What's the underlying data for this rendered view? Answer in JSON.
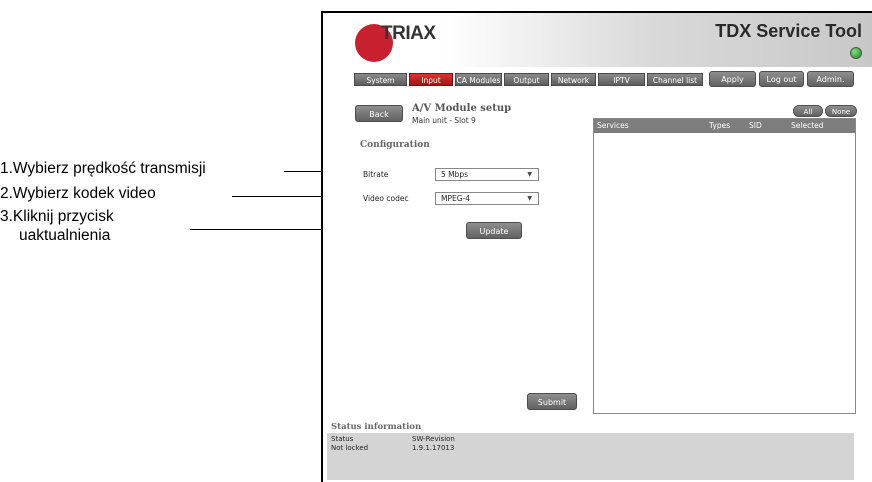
{
  "annotations": [
    {
      "text": "1.Wybierz prędkość transmisji"
    },
    {
      "text": "2.Wybierz kodek video"
    },
    {
      "text": "3.Kliknij przycisk"
    },
    {
      "text": "uaktualnienia"
    }
  ],
  "header": {
    "logo_text": "TRIAX",
    "title": "TDX Service Tool"
  },
  "nav": {
    "tabs": [
      {
        "label": "System"
      },
      {
        "label": "Input"
      },
      {
        "label": "CA Modules"
      },
      {
        "label": "Output"
      },
      {
        "label": "Network"
      },
      {
        "label": "IPTV"
      },
      {
        "label": "Channel list"
      }
    ],
    "active_tab": "Input",
    "apply": "Apply",
    "logout": "Log out",
    "admin": "Admin."
  },
  "panel": {
    "back": "Back",
    "title": "A/V Module setup",
    "subtitle": "Main unit - Slot 9",
    "config_title": "Configuration",
    "bitrate_label": "Bitrate",
    "bitrate_value": "5 Mbps",
    "codec_label": "Video codec",
    "codec_value": "MPEG-4",
    "update": "Update",
    "submit": "Submit"
  },
  "services": {
    "all": "All",
    "none": "None",
    "columns": [
      "Services",
      "Types",
      "SID",
      "Selected services"
    ]
  },
  "status": {
    "title": "Status information",
    "col1_header": "Status",
    "col2_header": "SW-Revision",
    "status_value": "Not locked",
    "revision_value": "1.9.1.17013"
  },
  "colors": {
    "accent_red": "#c8202f",
    "led_green": "#2aa02a",
    "button_gray": "#707070"
  }
}
